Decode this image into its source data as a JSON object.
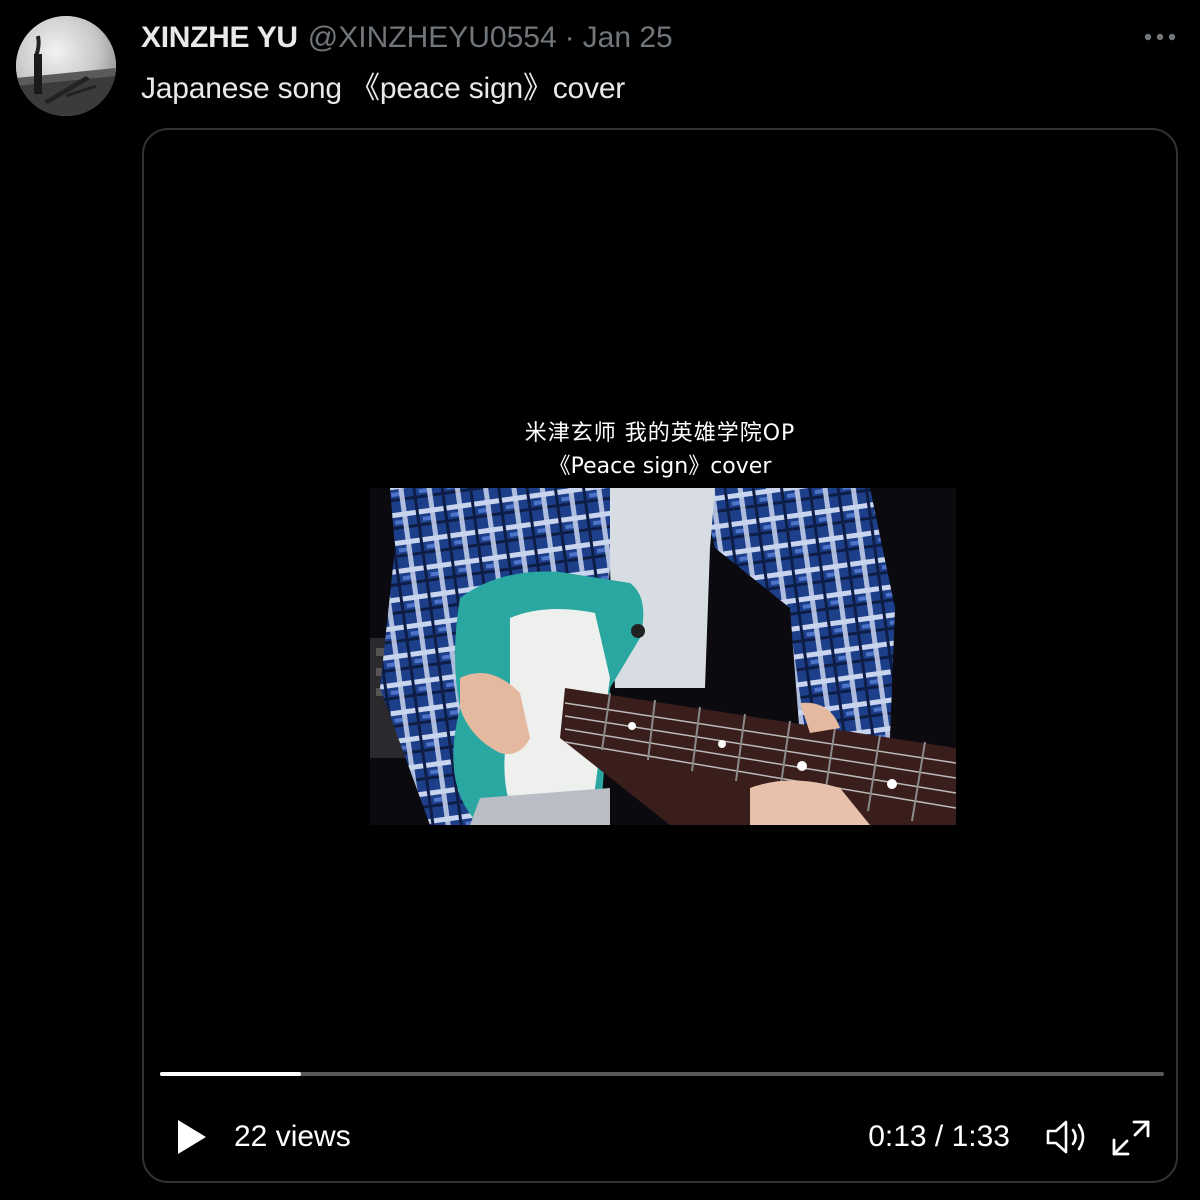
{
  "author": {
    "display_name": "XINZHE YU",
    "handle": "@XINZHEYU0554",
    "separator": "·",
    "date": "Jan 25"
  },
  "tweet": {
    "text": "Japanese song 《peace sign》cover"
  },
  "video": {
    "overlay_line1": "米津玄师 我的英雄学院OP",
    "overlay_line2": "《Peace sign》cover",
    "views": "22 views",
    "time": "0:13 / 1:33",
    "progress_fraction": 0.14,
    "colors": {
      "shirt": "#1d3f8a",
      "guitar": "#2aa7a0",
      "fretboard": "#3a1e1c"
    }
  },
  "icons": {
    "more": "more-dots-icon",
    "play": "play-icon",
    "volume": "volume-icon",
    "fullscreen": "fullscreen-icon"
  }
}
